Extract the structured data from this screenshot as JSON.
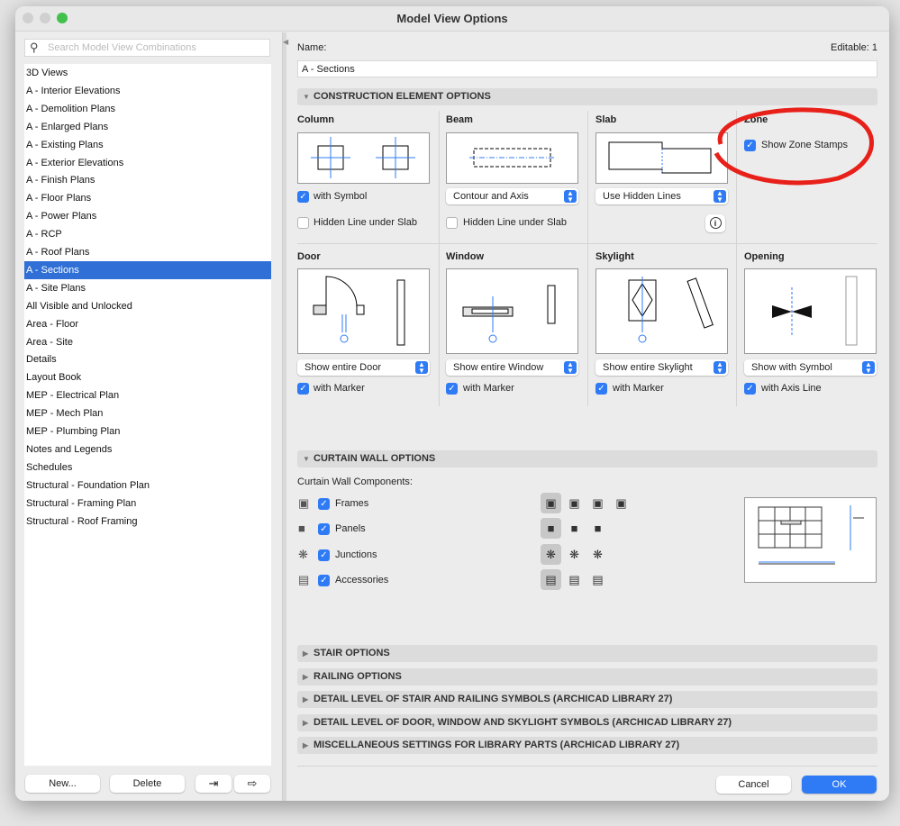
{
  "window": {
    "title": "Model View Options"
  },
  "sidebar": {
    "search_placeholder": "Search Model View Combinations",
    "items": [
      "3D Views",
      "A  - Interior Elevations",
      "A - Demolition Plans",
      "A - Enlarged Plans",
      "A - Existing Plans",
      "A - Exterior Elevations",
      "A - Finish Plans",
      "A - Floor Plans",
      "A - Power Plans",
      "A - RCP",
      "A - Roof Plans",
      "A - Sections",
      "A - Site Plans",
      "All Visible and Unlocked",
      "Area - Floor",
      "Area - Site",
      "Details",
      "Layout Book",
      "MEP - Electrical Plan",
      "MEP - Mech Plan",
      "MEP - Plumbing Plan",
      "Notes and Legends",
      "Schedules",
      "Structural - Foundation Plan",
      "Structural - Framing Plan",
      "Structural - Roof Framing"
    ],
    "selected": "A - Sections",
    "new_label": "New...",
    "delete_label": "Delete"
  },
  "main": {
    "name_label": "Name:",
    "editable_label": "Editable: 1",
    "name_value": "A - Sections",
    "construction_header": "CONSTRUCTION ELEMENT OPTIONS",
    "column": {
      "label": "Column",
      "check": "with Symbol",
      "check2": "Hidden Line under Slab"
    },
    "beam": {
      "label": "Beam",
      "select": "Contour and Axis",
      "check2": "Hidden Line under Slab"
    },
    "slab": {
      "label": "Slab",
      "select": "Use Hidden Lines"
    },
    "zone": {
      "label": "Zone",
      "check": "Show Zone Stamps"
    },
    "door": {
      "label": "Door",
      "select": "Show entire Door",
      "check": "with Marker"
    },
    "window": {
      "label": "Window",
      "select": "Show entire Window",
      "check": "with Marker"
    },
    "skylight": {
      "label": "Skylight",
      "select": "Show entire Skylight",
      "check": "with Marker"
    },
    "opening": {
      "label": "Opening",
      "select": "Show with Symbol",
      "check": "with Axis Line"
    },
    "curtain_header": "CURTAIN WALL OPTIONS",
    "components_label": "Curtain Wall Components:",
    "components": [
      "Frames",
      "Panels",
      "Junctions",
      "Accessories"
    ],
    "collapsed": [
      "STAIR OPTIONS",
      "RAILING OPTIONS",
      "DETAIL LEVEL OF STAIR AND RAILING SYMBOLS (ARCHICAD LIBRARY 27)",
      "DETAIL LEVEL OF DOOR, WINDOW AND SKYLIGHT SYMBOLS (ARCHICAD LIBRARY 27)",
      "MISCELLANEOUS SETTINGS FOR LIBRARY PARTS (ARCHICAD LIBRARY 27)"
    ],
    "cancel_label": "Cancel",
    "ok_label": "OK"
  },
  "colors": {
    "accent": "#2f7bf5",
    "selection": "#2f6fd6",
    "annotation": "#e8201a"
  }
}
